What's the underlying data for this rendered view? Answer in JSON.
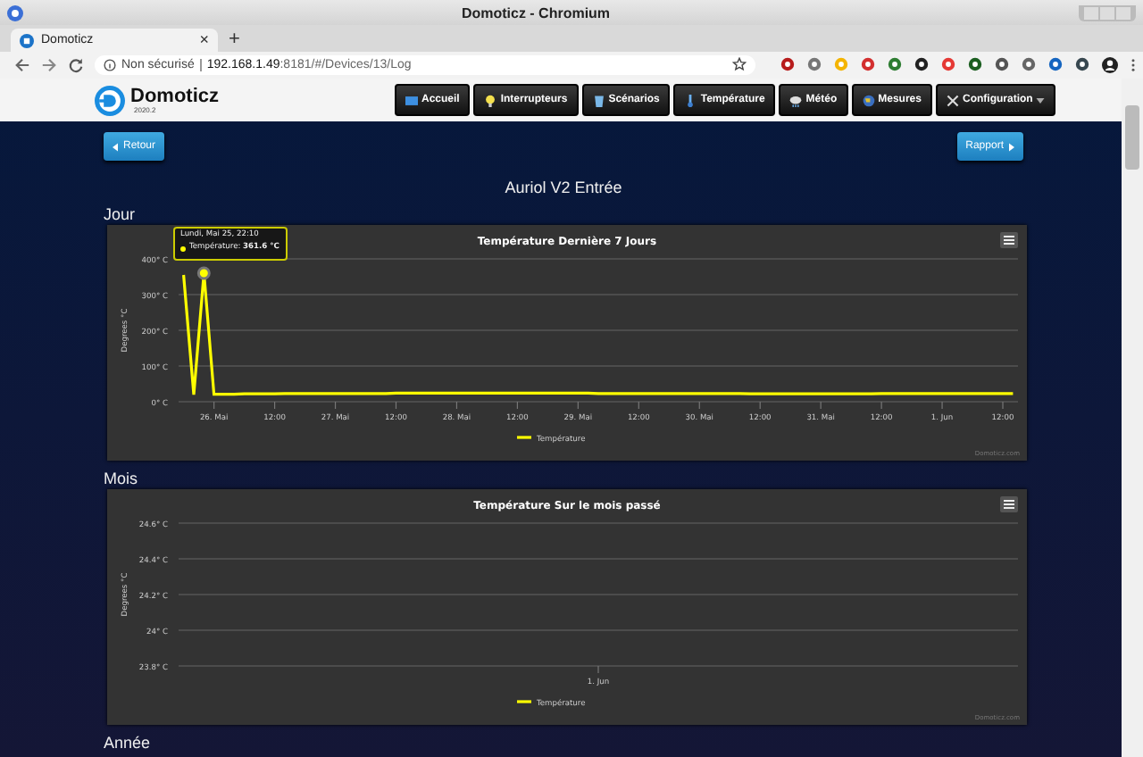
{
  "browser": {
    "window_title": "Domoticz - Chromium",
    "tab": {
      "title": "Domoticz",
      "close": "×"
    },
    "new_tab": "+",
    "security": "Non sécurisé",
    "url_host": "192.168.1.49",
    "url_rest": ":8181/#/Devices/13/Log"
  },
  "app": {
    "logo": "Domoticz",
    "version": "2020.2",
    "nav": [
      {
        "label": "Accueil",
        "dropdown": false
      },
      {
        "label": "Interrupteurs",
        "dropdown": false
      },
      {
        "label": "Scénarios",
        "dropdown": false
      },
      {
        "label": "Température",
        "dropdown": false
      },
      {
        "label": "Météo",
        "dropdown": false
      },
      {
        "label": "Mesures",
        "dropdown": false
      },
      {
        "label": "Configuration",
        "dropdown": true
      }
    ]
  },
  "page": {
    "back": "Retour",
    "report": "Rapport",
    "title": "Auriol V2 Entrée",
    "sections": [
      {
        "heading": "Jour",
        "credits": "Domoticz.com",
        "tooltip": {
          "title": "Lundi, Mai 25, 22:10",
          "text": "Température: **361.6 °C**"
        },
        "chart_data": {
          "type": "line",
          "title": "Température Dernière 7 Jours",
          "ylabel": "Degrees °C",
          "grid": true,
          "categories": [
            null,
            null,
            null,
            "26. Mai",
            null,
            null,
            null,
            null,
            null,
            "12:00",
            null,
            null,
            null,
            null,
            null,
            "27. Mai",
            null,
            null,
            null,
            null,
            null,
            "12:00",
            null,
            null,
            null,
            null,
            null,
            "28. Mai",
            null,
            null,
            null,
            null,
            null,
            "12:00",
            null,
            null,
            null,
            null,
            null,
            "29. Mai",
            null,
            null,
            null,
            null,
            null,
            "12:00",
            null,
            null,
            null,
            null,
            null,
            "30. Mai",
            null,
            null,
            null,
            null,
            null,
            "12:00",
            null,
            null,
            null,
            null,
            null,
            "31. Mai",
            null,
            null,
            null,
            null,
            null,
            "12:00",
            null,
            null,
            null,
            null,
            null,
            "1. Jun",
            null,
            null,
            null,
            null,
            null,
            "12:00",
            null
          ],
          "series": [
            {
              "name": "Température",
              "color": "#ffff00",
              "values": [
                355,
                20,
                360,
                21,
                21,
                21,
                22,
                22,
                22,
                22,
                23,
                23,
                23,
                23,
                23,
                23,
                23,
                23,
                23,
                23,
                23,
                24,
                24,
                24,
                24,
                24,
                24,
                24,
                24,
                24,
                24,
                24,
                24,
                24,
                24,
                24,
                24,
                24,
                24,
                24,
                24,
                23,
                23,
                23,
                23,
                23,
                23,
                23,
                23,
                23,
                23,
                23,
                23,
                23,
                23,
                23,
                22,
                22,
                22,
                22,
                22,
                22,
                22,
                22,
                22,
                22,
                22,
                22,
                22,
                23,
                23,
                23,
                23,
                23,
                23,
                23,
                23,
                23,
                23,
                23,
                23,
                23,
                23
              ]
            }
          ],
          "ylim": [
            0,
            400
          ],
          "yticks": [
            {
              "value": 0,
              "label": "0° C"
            },
            {
              "value": 100,
              "label": "100° C"
            },
            {
              "value": 200,
              "label": "200° C"
            },
            {
              "value": 300,
              "label": "300° C"
            },
            {
              "value": 400,
              "label": "400° C"
            }
          ]
        }
      },
      {
        "heading": "Mois",
        "credits": "Domoticz.com",
        "chart_data": {
          "type": "line",
          "title": "Température Sur le mois passé",
          "ylabel": "Degrees °C",
          "grid": true,
          "categories": [
            "1. Jun"
          ],
          "series": [
            {
              "name": "Température",
              "color": "#ffff00",
              "values": [
                null
              ]
            }
          ],
          "ylim": [
            23.8,
            24.6
          ],
          "yticks": [
            {
              "value": 23.8,
              "label": "23.8° C"
            },
            {
              "value": 24,
              "label": "24° C"
            },
            {
              "value": 24.2,
              "label": "24.2° C"
            },
            {
              "value": 24.4,
              "label": "24.4° C"
            },
            {
              "value": 24.6,
              "label": "24.6° C"
            }
          ]
        }
      }
    ],
    "last_heading": "Année"
  }
}
